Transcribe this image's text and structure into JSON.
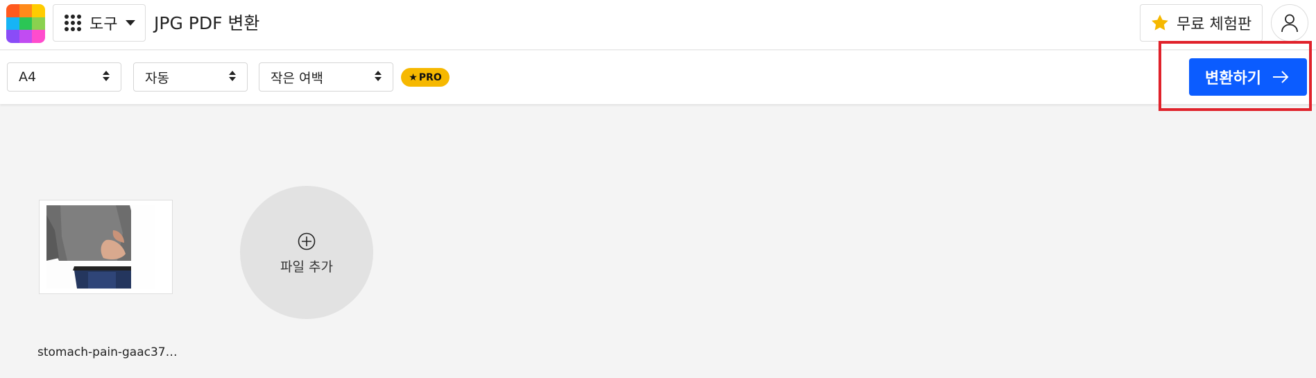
{
  "header": {
    "tools_label": "도구",
    "page_title": "JPG PDF 변환",
    "trial_label": "무료 체험판",
    "logo_colors": [
      "#ff5a1f",
      "#ff8a1a",
      "#ffcc00",
      "#16b4f5",
      "#2bc655",
      "#8ad14f",
      "#8a4cf7",
      "#c14cf2",
      "#ff4ccd"
    ]
  },
  "toolbar": {
    "page_size": "A4",
    "orientation": "자동",
    "margin": "작은 여백",
    "pro_label": "PRO",
    "convert_label": "변환하기"
  },
  "workspace": {
    "files": [
      {
        "name": "stomach-pain-gaac37…",
        "icon": "image-thumbnail"
      }
    ],
    "add_file_label": "파일 추가"
  },
  "colors": {
    "accent": "#0b5cff",
    "pro_badge": "#f6b800",
    "highlight_box": "#e0222b"
  }
}
